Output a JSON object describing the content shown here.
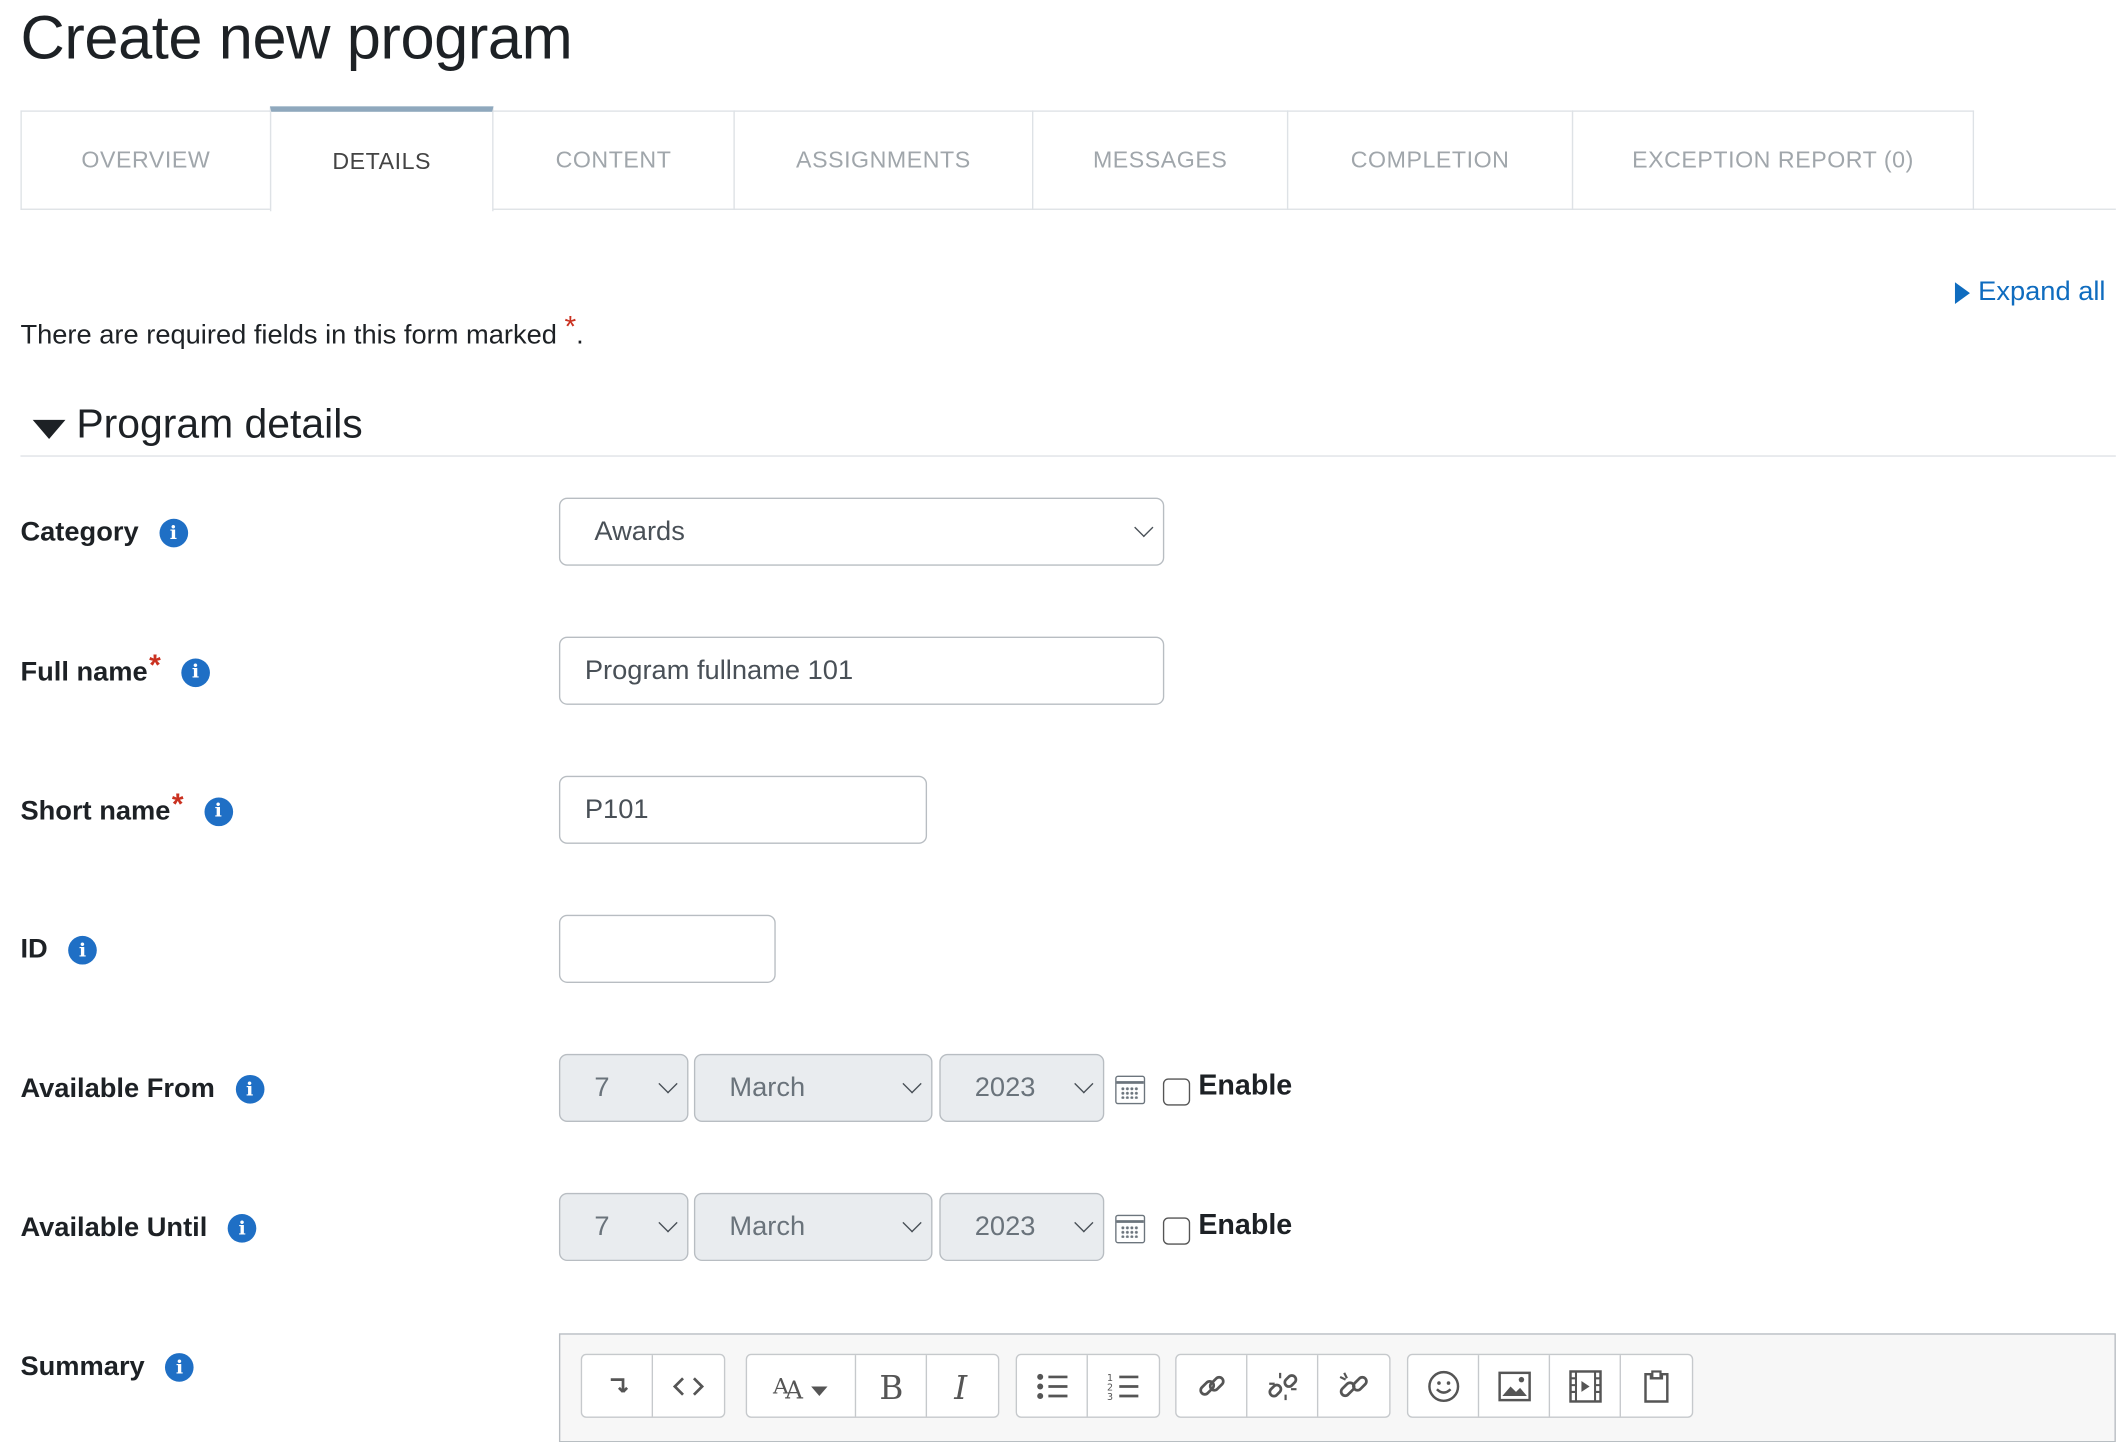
{
  "page": {
    "title": "Create new program"
  },
  "tabs": [
    {
      "label": "OVERVIEW"
    },
    {
      "label": "DETAILS"
    },
    {
      "label": "CONTENT"
    },
    {
      "label": "ASSIGNMENTS"
    },
    {
      "label": "MESSAGES"
    },
    {
      "label": "COMPLETION"
    },
    {
      "label": "EXCEPTION REPORT (0)"
    }
  ],
  "active_tab": "DETAILS",
  "expand_all": "Expand all",
  "required_note": {
    "text": "There are required fields in this form marked",
    "marker": "*",
    "end": "."
  },
  "section": {
    "title": "Program details"
  },
  "fields": {
    "category": {
      "label": "Category",
      "value": "Awards"
    },
    "fullname": {
      "label": "Full name",
      "value": "Program fullname 101"
    },
    "shortname": {
      "label": "Short name",
      "value": "P101"
    },
    "idnumber": {
      "label": "ID",
      "value": ""
    },
    "available_from": {
      "label": "Available From",
      "day": "7",
      "month": "March",
      "year": "2023",
      "enable_label": "Enable",
      "enabled": false
    },
    "available_until": {
      "label": "Available Until",
      "day": "7",
      "month": "March",
      "year": "2023",
      "enable_label": "Enable",
      "enabled": false
    },
    "summary": {
      "label": "Summary"
    }
  },
  "required_marker": "*",
  "info_glyph": "i",
  "editor_toolbar": [
    [
      "toggle-toolbar-icon",
      "html-source-icon"
    ],
    [
      "font-size-icon",
      "bold-icon",
      "italic-icon"
    ],
    [
      "unordered-list-icon",
      "ordered-list-icon"
    ],
    [
      "link-icon",
      "unlink-icon",
      "autolink-icon"
    ],
    [
      "emoticon-icon",
      "image-icon",
      "media-icon",
      "paste-icon"
    ]
  ],
  "colors": {
    "link": "#0f6cbf",
    "required": "#ca3120",
    "info": "#1f6fc5",
    "active_tab_border": "#8fa8bd"
  }
}
